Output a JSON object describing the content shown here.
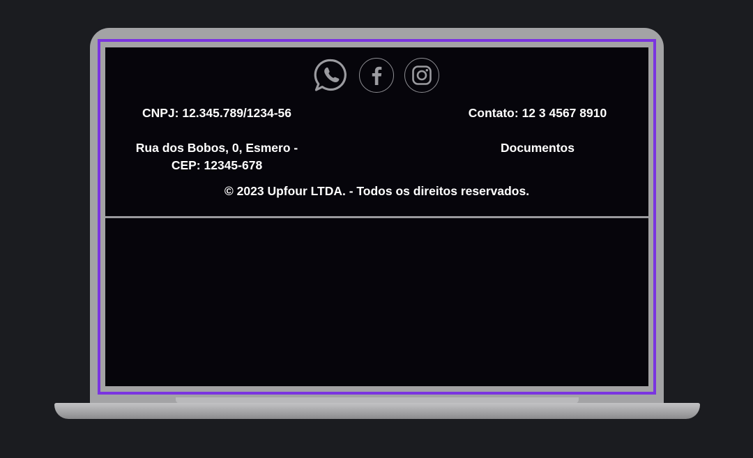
{
  "social": {
    "whatsapp_icon": "whatsapp-icon",
    "facebook_icon": "facebook-icon",
    "instagram_icon": "instagram-icon"
  },
  "footer": {
    "cnpj": "CNPJ: 12.345.789/1234-56",
    "contact": "Contato: 12 3 4567 8910",
    "address_line1": "Rua dos Bobos, 0, Esmero -",
    "address_line2": "CEP: 12345-678",
    "documents_link": "Documentos",
    "copyright": "© 2023 Upfour LTDA. - Todos os direitos reservados."
  },
  "colors": {
    "background": "#1b1c20",
    "laptop_body": "#a3a3a5",
    "accent_border": "#7a34e0",
    "screen": "#06050b",
    "text": "#ffffff"
  }
}
